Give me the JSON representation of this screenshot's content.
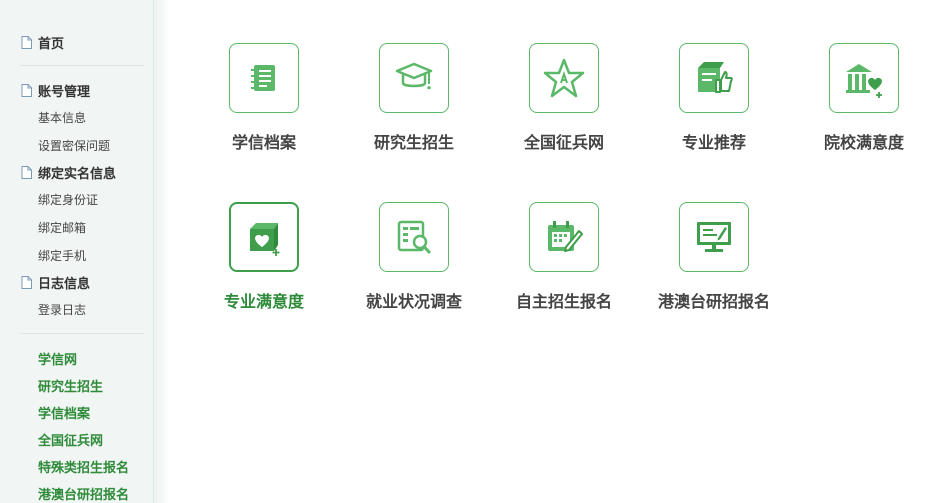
{
  "sidebar": {
    "home": "首页",
    "account": {
      "title": "账号管理",
      "items": [
        "基本信息",
        "设置密保问题"
      ]
    },
    "realname": {
      "title": "绑定实名信息",
      "items": [
        "绑定身份证",
        "绑定邮箱",
        "绑定手机"
      ]
    },
    "log": {
      "title": "日志信息",
      "items": [
        "登录日志"
      ]
    },
    "links": [
      "学信网",
      "研究生招生",
      "学信档案",
      "全国征兵网",
      "特殊类招生报名",
      "港澳台研招报名"
    ]
  },
  "tiles": [
    {
      "label": "学信档案",
      "icon": "notebook-icon"
    },
    {
      "label": "研究生招生",
      "icon": "graduation-cap-icon"
    },
    {
      "label": "全国征兵网",
      "icon": "army-star-icon"
    },
    {
      "label": "专业推荐",
      "icon": "thumbs-up-book-icon"
    },
    {
      "label": "院校满意度",
      "icon": "school-heart-icon"
    },
    {
      "label": "专业满意度",
      "icon": "book-heart-icon"
    },
    {
      "label": "就业状况调查",
      "icon": "survey-magnifier-icon"
    },
    {
      "label": "自主招生报名",
      "icon": "calendar-pencil-icon"
    },
    {
      "label": "港澳台研招报名",
      "icon": "monitor-pen-icon"
    }
  ],
  "colors": {
    "accent": "#3f9e4b",
    "sidebar_bg": "#f1f5f3",
    "link": "#2e8b3a"
  }
}
